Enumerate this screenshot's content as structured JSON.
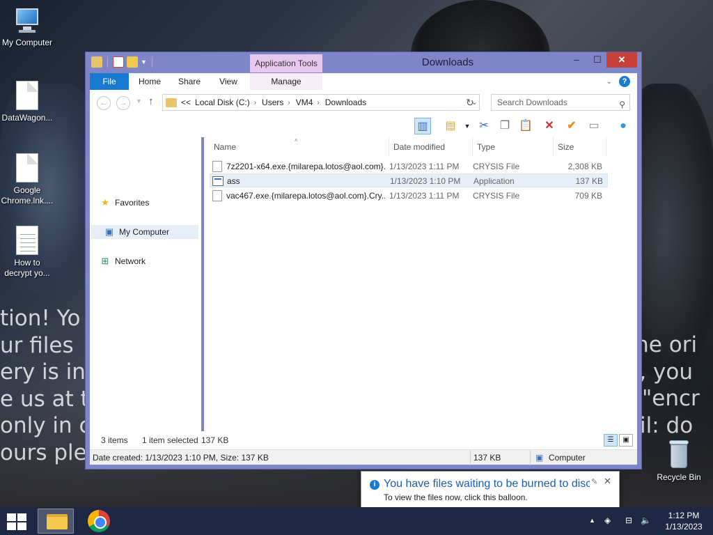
{
  "desktop": {
    "icons": [
      {
        "label": "My Computer"
      },
      {
        "label": "DataWagon..."
      },
      {
        "label": "Google Chrome.lnk...."
      },
      {
        "label": "How to decrypt yo..."
      },
      {
        "label": "Recycle Bin"
      }
    ],
    "ransom_left_lines": [
      "tion! Yo",
      "ur files",
      "ery is in",
      "e us at t",
      "only in c",
      "ours plea"
    ],
    "ransom_right_lines": [
      "the ori",
      "y, you",
      "t \"encr",
      "ail: do"
    ]
  },
  "window": {
    "title": "Downloads",
    "context_tab_header": "Application Tools",
    "ribbon_tabs": {
      "file": "File",
      "home": "Home",
      "share": "Share",
      "view": "View",
      "manage": "Manage"
    },
    "controls": {
      "minimize": "–",
      "maximize": "☐",
      "close": "✕"
    },
    "address": {
      "overflow": "<<",
      "crumbs": [
        "Local Disk (C:)",
        "Users",
        "VM4",
        "Downloads"
      ]
    },
    "search": {
      "placeholder": "Search Downloads"
    },
    "nav_pane": {
      "favorites": "Favorites",
      "my_computer": "My Computer",
      "network": "Network"
    },
    "columns": {
      "name": "Name",
      "date_modified": "Date modified",
      "type": "Type",
      "size": "Size"
    },
    "files": [
      {
        "name": "7z2201-x64.exe.{milarepa.lotos@aol.com}...",
        "date": "1/13/2023 1:11 PM",
        "type": "CRYSIS File",
        "size": "2,308 KB"
      },
      {
        "name": "ass",
        "date": "1/13/2023 1:10 PM",
        "type": "Application",
        "size": "137 KB"
      },
      {
        "name": "vac467.exe.{milarepa.lotos@aol.com}.Cry...",
        "date": "1/13/2023 1:11 PM",
        "type": "CRYSIS File",
        "size": "709 KB"
      }
    ],
    "status": {
      "item_count": "3 items",
      "selected": "1 item selected",
      "selected_size": "137 KB"
    },
    "details_bar": {
      "info": "Date created: 1/13/2023 1:10 PM, Size: 137 KB",
      "size": "137 KB",
      "location": "Computer"
    }
  },
  "balloon": {
    "title": "You have files waiting to be burned to disc",
    "body": "To view the files now, click this balloon."
  },
  "taskbar": {
    "time": "1:12 PM",
    "date": "1/13/2023"
  },
  "colors": {
    "accent": "#1a7ad2",
    "window_frame": "#7f86c8",
    "close_button": "#c7403a",
    "context_tab": "#e9c8f0"
  }
}
